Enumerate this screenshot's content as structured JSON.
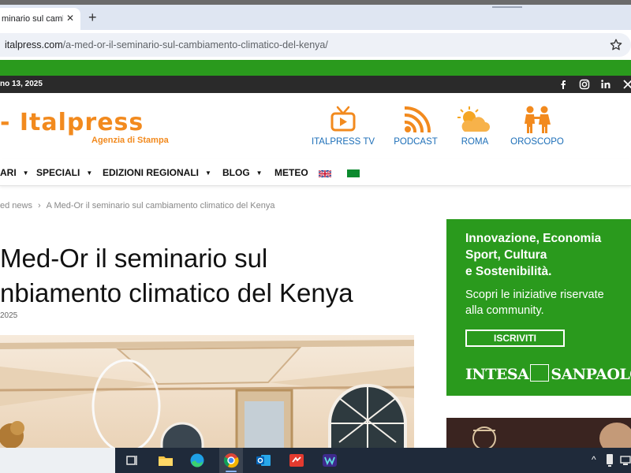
{
  "browser": {
    "tab_title": "minario sul camb",
    "url_host": "italpress.com",
    "url_path": "/a-med-or-il-seminario-sul-cambiamento-climatico-del-kenya/"
  },
  "site": {
    "date": "no 13, 2025",
    "logo_text": "- Italpress",
    "logo_tagline": "Agenzia di Stampa",
    "header_items": [
      {
        "label": "ITALPRESS TV",
        "icon": "tv-icon"
      },
      {
        "label": "PODCAST",
        "icon": "podcast-icon"
      },
      {
        "label": "ROMA",
        "icon": "weather-icon"
      },
      {
        "label": "OROSCOPO",
        "icon": "kids-icon"
      }
    ],
    "nav": {
      "item1": "ARI",
      "item2": "SPECIALI",
      "item3": "EDIZIONI REGIONALI",
      "item4": "BLOG",
      "item5": "METEO"
    },
    "breadcrumb": {
      "parent": "ed news",
      "sep": "›",
      "current": "A Med-Or il seminario sul cambiamento climatico del Kenya"
    },
    "headline": {
      "line1": "Med-Or il seminario sul",
      "line2": "nbiamento climatico del Kenya"
    },
    "pubdate": "2025",
    "colors": {
      "brand_orange": "#f28a1e",
      "brand_green": "#2a9a1d",
      "link_blue": "#1d6fb8"
    }
  },
  "ad": {
    "headline": {
      "line1": "Innovazione, Economia",
      "line2": "Sport, Cultura",
      "line3": "e Sostenibilità."
    },
    "body": {
      "line1": "Scopri le iniziative riservate",
      "line2": "alla community."
    },
    "button": "ISCRIVITI",
    "brand_left": "INTESA",
    "brand_right": "SANPAOLO"
  }
}
